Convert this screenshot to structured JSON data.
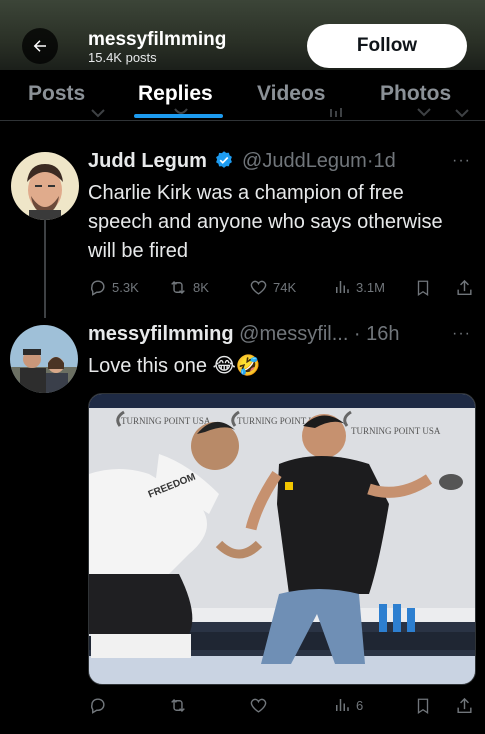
{
  "header": {
    "account_name": "messyfilmming",
    "post_count": "15.4K posts",
    "follow_label": "Follow"
  },
  "tabs": [
    {
      "label": "Posts",
      "active": false
    },
    {
      "label": "Replies",
      "active": true
    },
    {
      "label": "Videos",
      "active": false
    },
    {
      "label": "Photos",
      "active": false
    }
  ],
  "quoted_post": {
    "author_name": "Judd Legum",
    "handle": "@JuddLegum",
    "time": "1d",
    "text": "Charlie Kirk was a champion of free speech and anyone who says otherwise will be fired",
    "replies": "5.3K",
    "reposts": "8K",
    "likes": "74K",
    "views": "3.1M"
  },
  "reply_post": {
    "author_name": "messyfilmming",
    "handle": "@messyfil...",
    "time": "16h",
    "text": "Love this one",
    "emojis": "😂🤣",
    "views": "6",
    "image_signs": [
      "TURNING POINT USA",
      "TURNING POINT USA",
      "TURNING POINT USA"
    ],
    "image_shirt_text": "FREEDOM"
  },
  "colors": {
    "accent": "#1d9bf0",
    "verified": "#1d9bf0",
    "muted": "#71767b",
    "background": "#000000"
  },
  "icons": [
    "back-arrow-icon",
    "verified-badge-icon",
    "reply-icon",
    "repost-icon",
    "like-icon",
    "views-icon",
    "bookmark-icon",
    "share-icon",
    "more-icon"
  ]
}
